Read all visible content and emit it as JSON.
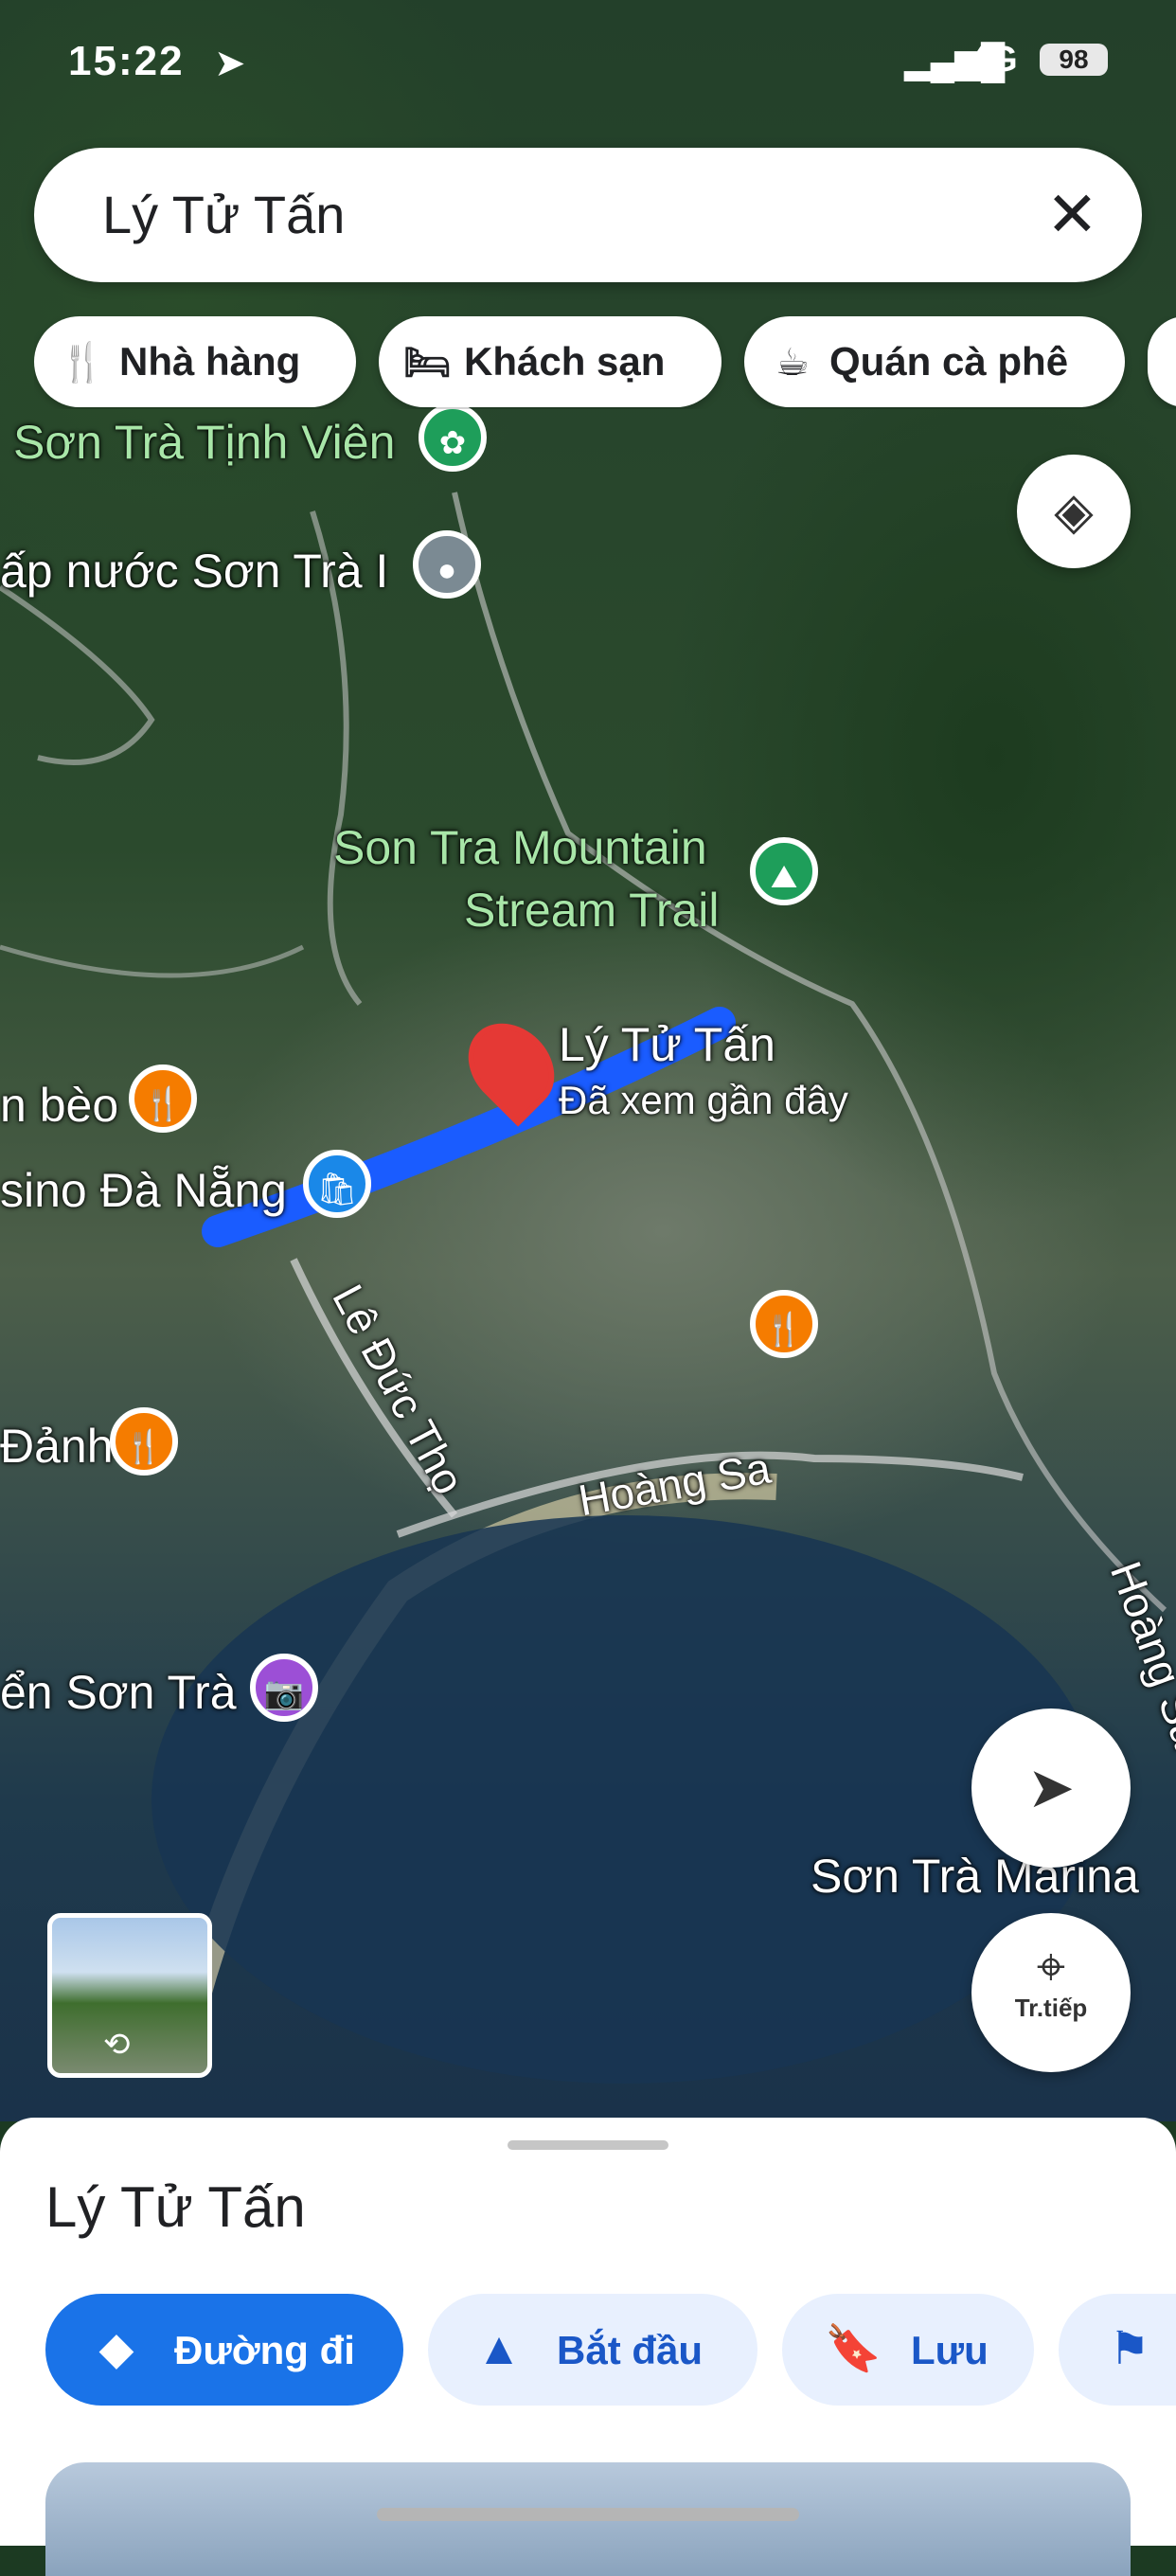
{
  "status_bar": {
    "time": "15:22",
    "signal": "▂▄▆█",
    "network": "4G",
    "battery": "98"
  },
  "search": {
    "query": "Lý Tử Tấn",
    "clear_icon": "close-icon"
  },
  "chips": [
    {
      "label": "Nhà hàng",
      "icon": "restaurant-icon"
    },
    {
      "label": "Khách sạn",
      "icon": "hotel-icon"
    },
    {
      "label": "Quán cà phê",
      "icon": "coffee-icon"
    }
  ],
  "map": {
    "labels": [
      "Sơn Trà Tịnh Viên",
      "ấp nước Sơn Trà I",
      "Son Tra Mountain",
      "Stream Trail",
      "n bèo",
      "sino Đà Nẵng",
      "Lê Đức Thọ",
      "Đảnh",
      "Hoàng Sa",
      "ển Sơn Trà",
      "Sơn Trà Marina",
      "Hoàng Sa"
    ],
    "selected_place": {
      "name": "Lý Tử Tấn",
      "subtitle": "Đã xem gần đây"
    },
    "live_view_label": "Tr.tiếp",
    "colors": {
      "route": "#1a5cff",
      "selected_pin": "#e53935",
      "restaurant_pin": "#f57c00",
      "park_pin": "#1e9e5a",
      "shopping_pin": "#1a88e8",
      "museum_pin": "#9c4fd6"
    }
  },
  "sheet": {
    "title": "Lý Tử Tấn",
    "actions": [
      {
        "label": "Đường đi",
        "icon": "directions-icon"
      },
      {
        "label": "Bắt đầu",
        "icon": "navigation-arrow-icon"
      },
      {
        "label": "Lưu",
        "icon": "bookmark-icon"
      }
    ]
  }
}
